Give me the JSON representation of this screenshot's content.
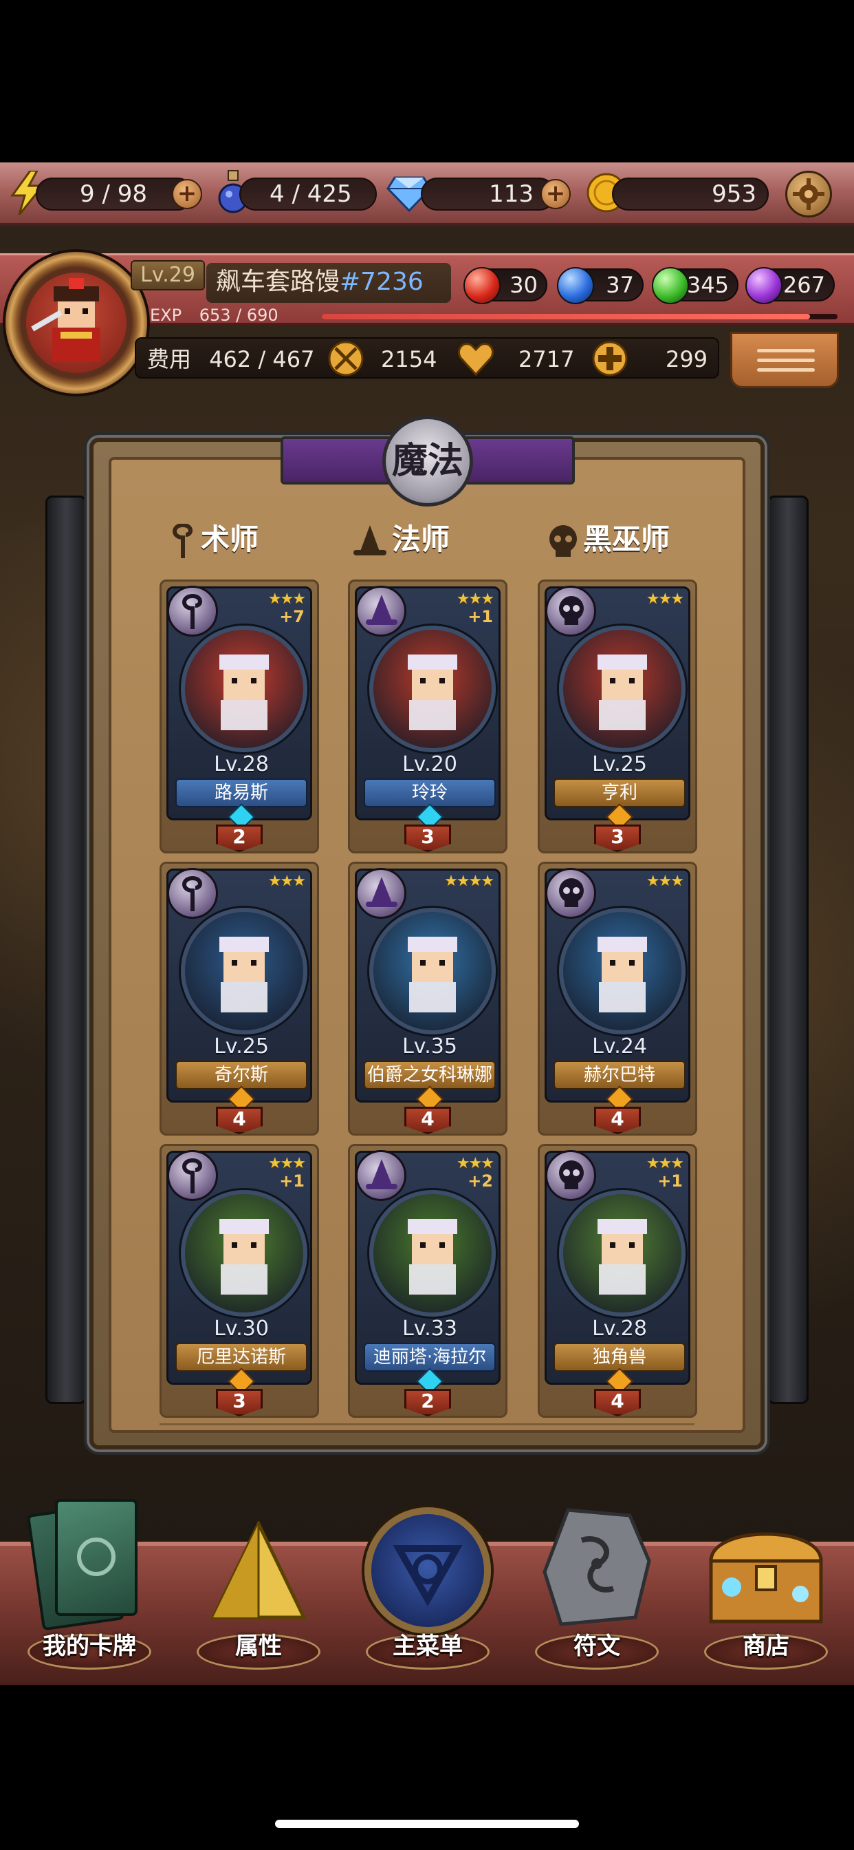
{
  "resources": {
    "energy": "9 / 98",
    "potion": "4 / 425",
    "diamond": "113",
    "gold": "953"
  },
  "player": {
    "level": "Lv.29",
    "name": "飙车套路馒",
    "tag": "#7236",
    "exp_label": "EXP",
    "exp_value": "653 / 690",
    "exp_fraction": 0.946,
    "orbs": {
      "red": "30",
      "blue": "37",
      "green": "345",
      "purple": "267"
    },
    "cost_label": "费用",
    "cost_value": "462 / 467",
    "attack": "2154",
    "defense": "2717",
    "health": "299"
  },
  "panel": {
    "title": "魔法",
    "columns": [
      "术师",
      "法师",
      "黑巫师"
    ]
  },
  "cards": [
    {
      "stars": "★★★",
      "plus": "+7",
      "level": "Lv.28",
      "name": "路易斯",
      "cost": "2",
      "plate": "blue",
      "bg": "#c43b2e",
      "class": "sorcerer"
    },
    {
      "stars": "★★★",
      "plus": "+1",
      "level": "Lv.20",
      "name": "玲玲",
      "cost": "3",
      "plate": "blue",
      "bg": "#b83a2a",
      "class": "mage"
    },
    {
      "stars": "★★★",
      "plus": "",
      "level": "Lv.25",
      "name": "亨利",
      "cost": "3",
      "plate": "gold",
      "bg": "#b3382c",
      "class": "warlock"
    },
    {
      "stars": "★★★",
      "plus": "",
      "level": "Lv.25",
      "name": "奇尔斯",
      "cost": "4",
      "plate": "gold",
      "bg": "#2e5a8c",
      "class": "sorcerer"
    },
    {
      "stars": "★★★★",
      "plus": "",
      "level": "Lv.35",
      "name": "伯爵之女科琳娜",
      "cost": "4",
      "plate": "gold",
      "bg": "#3272a8",
      "class": "mage"
    },
    {
      "stars": "★★★",
      "plus": "",
      "level": "Lv.24",
      "name": "赫尔巴特",
      "cost": "4",
      "plate": "gold",
      "bg": "#2f6aa0",
      "class": "warlock"
    },
    {
      "stars": "★★★",
      "plus": "+1",
      "level": "Lv.30",
      "name": "厄里达诺斯",
      "cost": "3",
      "plate": "gold",
      "bg": "#4e7d2e",
      "class": "sorcerer"
    },
    {
      "stars": "★★★",
      "plus": "+2",
      "level": "Lv.33",
      "name": "迪丽塔·海拉尔",
      "cost": "2",
      "plate": "blue",
      "bg": "#4a7a2c",
      "class": "mage"
    },
    {
      "stars": "★★★",
      "plus": "+1",
      "level": "Lv.28",
      "name": "独角兽",
      "cost": "4",
      "plate": "gold",
      "bg": "#527f33",
      "class": "warlock"
    }
  ],
  "nav": [
    {
      "label": "我的卡牌",
      "icon": "cards-icon"
    },
    {
      "label": "属性",
      "icon": "pyramid-icon"
    },
    {
      "label": "主菜单",
      "icon": "emblem-icon"
    },
    {
      "label": "符文",
      "icon": "rune-stone-icon"
    },
    {
      "label": "商店",
      "icon": "treasure-chest-icon"
    }
  ],
  "colors": {
    "resource_bar": "#a7625e",
    "player_panel": "#8d3b39",
    "board": "#a27c4e",
    "title_banner": "#4a2466",
    "blue_plate": "#2c4f85",
    "gold_plate": "#8b5c20",
    "cost_flag": "#b4432b"
  }
}
